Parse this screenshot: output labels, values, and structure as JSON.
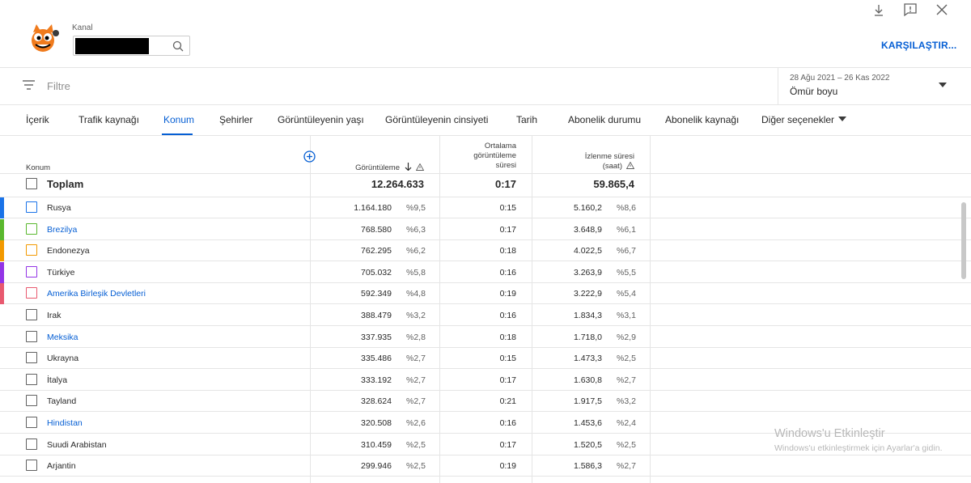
{
  "header": {
    "kanal_label": "Kanal",
    "compare_button": "KARŞILAŞTIR..."
  },
  "filter": {
    "placeholder": "Filtre",
    "date_range": "28 Ağu 2021 – 26 Kas 2022",
    "date_label": "Ömür boyu"
  },
  "tabs": [
    {
      "label": "İçerik"
    },
    {
      "label": "Trafik kaynağı"
    },
    {
      "label": "Konum"
    },
    {
      "label": "Şehirler"
    },
    {
      "label": "Görüntüleyenin yaşı"
    },
    {
      "label": "Görüntüleyenin cinsiyeti"
    },
    {
      "label": "Tarih"
    },
    {
      "label": "Abonelik durumu"
    },
    {
      "label": "Abonelik kaynağı"
    },
    {
      "label": "Diğer seçenekler"
    }
  ],
  "table": {
    "headers": {
      "location": "Konum",
      "views": "Görüntüleme",
      "avg_duration_line1": "Ortalama",
      "avg_duration_line2": "görüntüleme",
      "avg_duration_line3": "süresi",
      "watch_time_line1": "İzlenme süresi",
      "watch_time_line2": "(saat)"
    },
    "total": {
      "label": "Toplam",
      "views": "12.264.633",
      "avg_duration": "0:17",
      "watch_time": "59.865,4"
    },
    "rows": [
      {
        "name": "Rusya",
        "link": false,
        "views": "1.164.180",
        "views_pct": "%9,5",
        "avg": "0:15",
        "watch": "5.160,2",
        "watch_pct": "%8,6",
        "color": "#1a73e8"
      },
      {
        "name": "Brezilya",
        "link": true,
        "views": "768.580",
        "views_pct": "%6,3",
        "avg": "0:17",
        "watch": "3.648,9",
        "watch_pct": "%6,1",
        "color": "#5ab82e"
      },
      {
        "name": "Endonezya",
        "link": false,
        "views": "762.295",
        "views_pct": "%6,2",
        "avg": "0:18",
        "watch": "4.022,5",
        "watch_pct": "%6,7",
        "color": "#f29900"
      },
      {
        "name": "Türkiye",
        "link": false,
        "views": "705.032",
        "views_pct": "%5,8",
        "avg": "0:16",
        "watch": "3.263,9",
        "watch_pct": "%5,5",
        "color": "#9334e6"
      },
      {
        "name": "Amerika Birleşik Devletleri",
        "link": true,
        "views": "592.349",
        "views_pct": "%4,8",
        "avg": "0:19",
        "watch": "3.222,9",
        "watch_pct": "%5,4",
        "color": "#e8596f"
      },
      {
        "name": "Irak",
        "link": false,
        "views": "388.479",
        "views_pct": "%3,2",
        "avg": "0:16",
        "watch": "1.834,3",
        "watch_pct": "%3,1",
        "color": ""
      },
      {
        "name": "Meksika",
        "link": true,
        "views": "337.935",
        "views_pct": "%2,8",
        "avg": "0:18",
        "watch": "1.718,0",
        "watch_pct": "%2,9",
        "color": ""
      },
      {
        "name": "Ukrayna",
        "link": false,
        "views": "335.486",
        "views_pct": "%2,7",
        "avg": "0:15",
        "watch": "1.473,3",
        "watch_pct": "%2,5",
        "color": ""
      },
      {
        "name": "İtalya",
        "link": false,
        "views": "333.192",
        "views_pct": "%2,7",
        "avg": "0:17",
        "watch": "1.630,8",
        "watch_pct": "%2,7",
        "color": ""
      },
      {
        "name": "Tayland",
        "link": false,
        "views": "328.624",
        "views_pct": "%2,7",
        "avg": "0:21",
        "watch": "1.917,5",
        "watch_pct": "%3,2",
        "color": ""
      },
      {
        "name": "Hindistan",
        "link": true,
        "views": "320.508",
        "views_pct": "%2,6",
        "avg": "0:16",
        "watch": "1.453,6",
        "watch_pct": "%2,4",
        "color": ""
      },
      {
        "name": "Suudi Arabistan",
        "link": false,
        "views": "310.459",
        "views_pct": "%2,5",
        "avg": "0:17",
        "watch": "1.520,5",
        "watch_pct": "%2,5",
        "color": ""
      },
      {
        "name": "Arjantin",
        "link": false,
        "views": "299.946",
        "views_pct": "%2,5",
        "avg": "0:19",
        "watch": "1.586,3",
        "watch_pct": "%2,7",
        "color": ""
      }
    ]
  },
  "watermark": {
    "line1": "Windows'u Etkinleştir",
    "line2": "Windows'u etkinleştirmek için Ayarlar'a gidin."
  },
  "colors": {
    "accent": "#065fd4"
  }
}
